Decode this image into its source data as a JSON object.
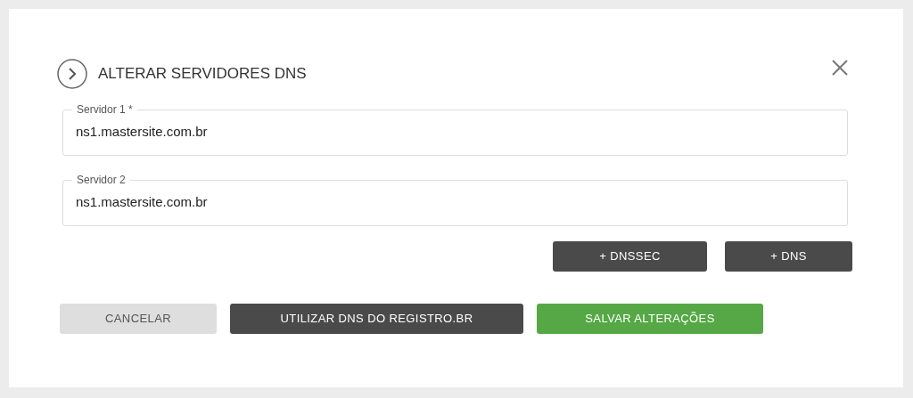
{
  "dialog": {
    "title": "ALTERAR SERVIDORES DNS"
  },
  "fields": [
    {
      "label": "Servidor 1 *",
      "value": "ns1.mastersite.com.br"
    },
    {
      "label": "Servidor 2",
      "value": "ns1.mastersite.com.br"
    }
  ],
  "add_buttons": [
    {
      "label": "+ DNSSEC",
      "kind": "dark"
    },
    {
      "label": "+ DNS",
      "kind": "dark"
    }
  ],
  "actions": [
    {
      "label": "CANCELAR",
      "kind": "light"
    },
    {
      "label": "UTILIZAR DNS DO REGISTRO.BR",
      "kind": "dark"
    },
    {
      "label": "SALVAR ALTERAÇÕES",
      "kind": "success"
    }
  ]
}
